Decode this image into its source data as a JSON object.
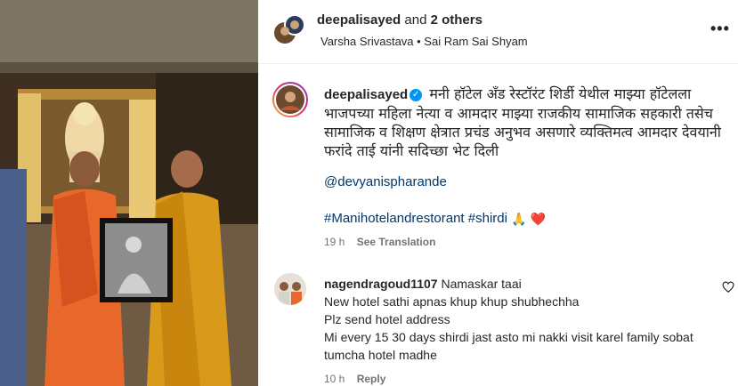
{
  "header": {
    "username": "deepalisayed",
    "and_text": "and",
    "others_text": "2 others",
    "collaborators": "Varsha Srivastava • Sai Ram Sai Shyam",
    "more_icon": "more-horizontal-icon",
    "more_label": "•••"
  },
  "post": {
    "username": "deepalisayed",
    "verified_icon": "verified-badge-icon",
    "verified_glyph": "✓",
    "caption": "मनी हॉटेल अँड रेस्टॉरंट शिर्डी येथील माझ्या हॉटेलला भाजपच्या महिला नेत्या व आमदार माझ्या राजकीय सामाजिक सहकारी तसेच सामाजिक व शिक्षण क्षेत्रात प्रचंड अनुभव असणारे व्यक्तिमत्व आमदार देवयानी फरांदे ताई यांनी सदिच्छा भेट दिली",
    "mention": "@devyanispharande",
    "hashtags": "#Manihotelandrestorant #shirdi",
    "emoji_pray": "🙏",
    "emoji_heart": "❤️",
    "time": "19 h",
    "see_translation": "See Translation"
  },
  "comment": {
    "username": "nagendragoud1107",
    "lines": [
      "Namaskar taai",
      "New hotel sathi apnas khup khup shubhechha",
      "Plz send hotel address",
      "Mi every 15 30 days shirdi jast asto mi nakki visit karel family sobat tumcha hotel madhe"
    ],
    "time": "10 h",
    "reply": "Reply",
    "like_icon": "heart-outline-icon"
  },
  "colors": {
    "link": "#00376b",
    "verified": "#0095f6",
    "meta": "#737373",
    "text": "#262626"
  }
}
